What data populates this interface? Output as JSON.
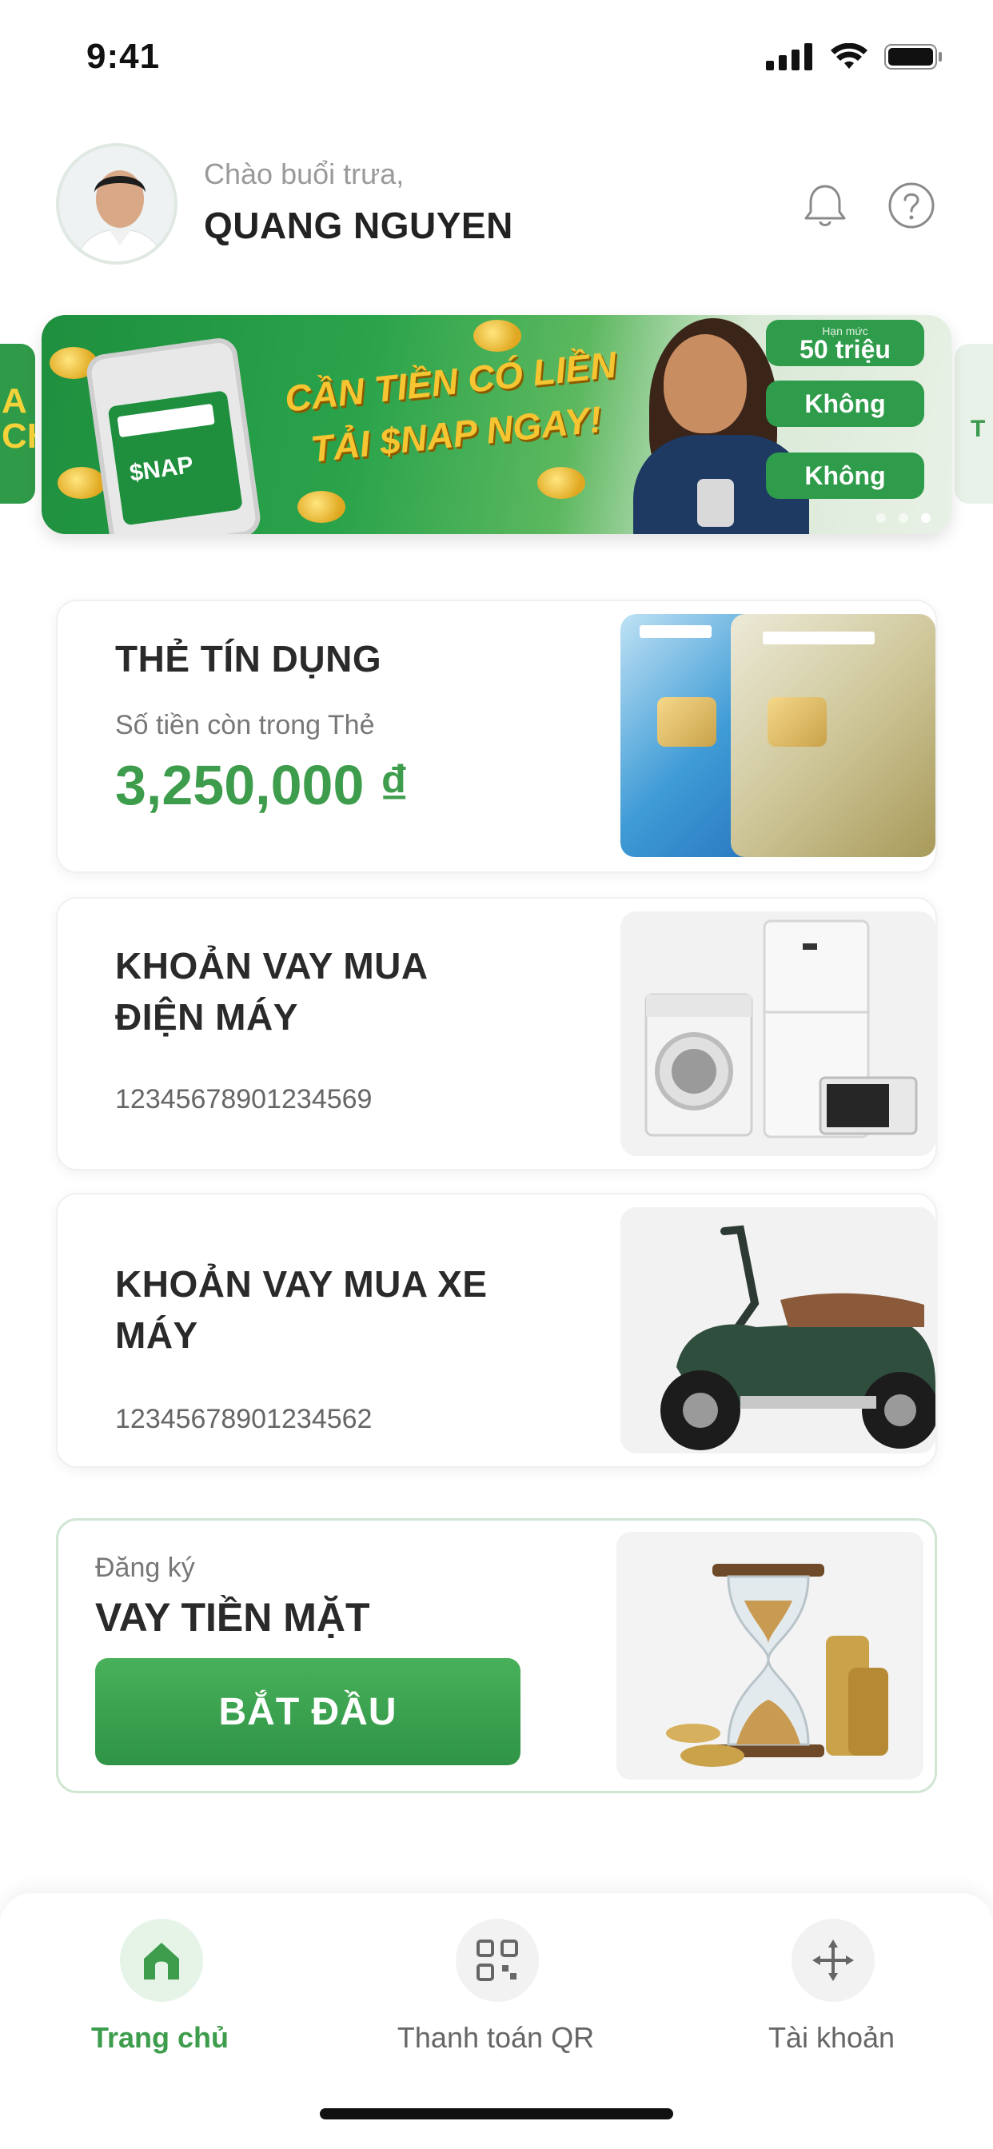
{
  "status_bar": {
    "time": "9:41"
  },
  "header": {
    "greeting": "Chào buổi trưa,",
    "user_name": "QUANG NGUYEN"
  },
  "banner": {
    "headline_line1": "CẦN TIỀN CÓ LIỀN",
    "headline_line2": "TẢI $NAP NGAY!",
    "phone_label": "$NAP",
    "pills": [
      {
        "label": "50 triệu",
        "caption": "Hạn mức"
      },
      {
        "label": "Không",
        "caption": ""
      },
      {
        "label": "Không",
        "caption": ""
      }
    ],
    "left_peek_text": "A\nCH",
    "right_peek_text": "T",
    "dots_count": 3,
    "active_dot": 2
  },
  "cards": [
    {
      "title": "THẺ TÍN DỤNG",
      "subtitle": "Số tiền còn trong Thẻ",
      "amount": "3,250,000 ₫"
    },
    {
      "title_line1": "KHOẢN VAY MUA",
      "title_line2": "ĐIỆN MÁY",
      "account_no": "12345678901234569"
    },
    {
      "title_line1": "KHOẢN VAY MUA XE",
      "title_line2": "MÁY",
      "account_no": "12345678901234562"
    }
  ],
  "cash_loan": {
    "pre_label": "Đăng ký",
    "title": "VAY TIỀN MẶT",
    "button_label": "BẮT ĐẦU"
  },
  "bottom_nav": {
    "items": [
      {
        "label": "Trang chủ",
        "icon": "home-icon",
        "active": true
      },
      {
        "label": "Thanh toán QR",
        "icon": "qr-scan-icon",
        "active": false
      },
      {
        "label": "Tài khoản",
        "icon": "account-icon",
        "active": false
      }
    ]
  },
  "colors": {
    "brand_green": "#3d9d4c",
    "banner_green": "#2aa34b",
    "headline_yellow": "#f6c531"
  }
}
